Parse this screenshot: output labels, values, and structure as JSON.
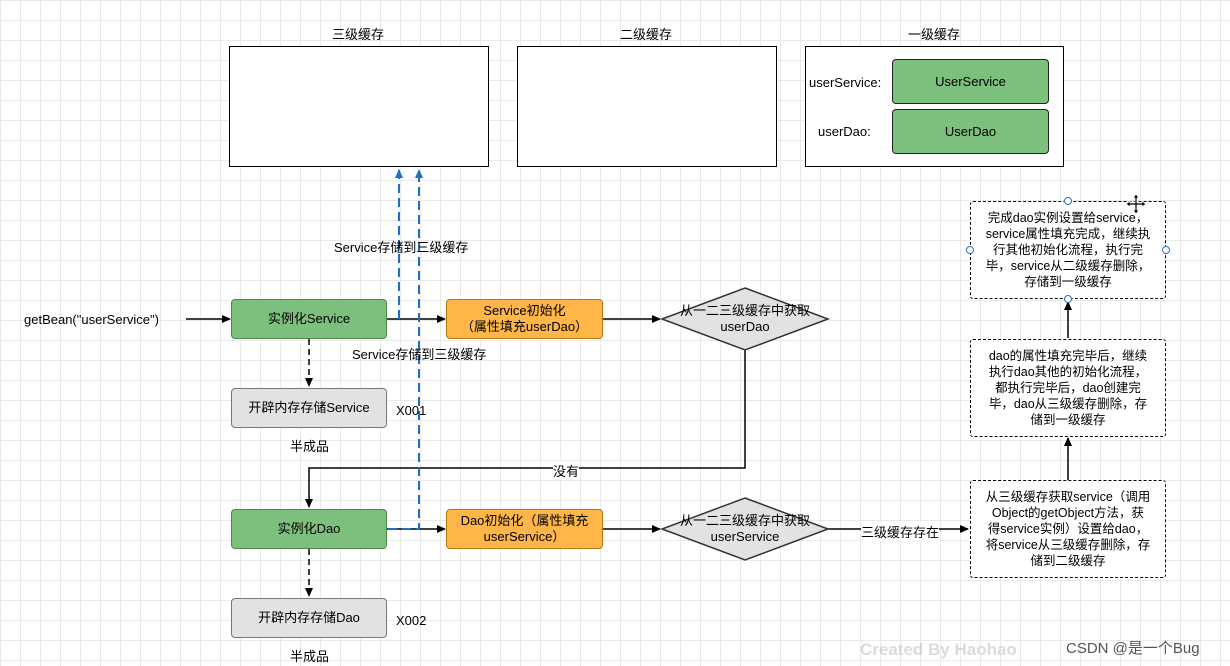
{
  "caches": {
    "level3": {
      "title": "三级缓存"
    },
    "level2": {
      "title": "二级缓存"
    },
    "level1": {
      "title": "一级缓存",
      "entries": [
        {
          "key": "userService:",
          "value": "UserService"
        },
        {
          "key": "userDao:",
          "value": "UserDao"
        }
      ]
    }
  },
  "flow": {
    "entry_label": "getBean(\"userService\")",
    "instantiate_service": "实例化Service",
    "service_memory": "开辟内存存储Service",
    "service_addr": "X001",
    "service_half": "半成品",
    "store_service_l3_a": "Service存储到三级缓存",
    "store_service_l3_b": "Service存储到三级缓存",
    "service_init_line1": "Service初始化",
    "service_init_line2": "（属性填充userDao）",
    "get_dao_line1": "从一二三级缓存中获取",
    "get_dao_line2": "userDao",
    "none_label": "没有",
    "instantiate_dao": "实例化Dao",
    "dao_memory": "开辟内存存储Dao",
    "dao_addr": "X002",
    "dao_half": "半成品",
    "dao_init_line1": "Dao初始化（属性填充",
    "dao_init_line2": "userService）",
    "get_service_line1": "从一二三级缓存中获取",
    "get_service_line2": "userService",
    "exists_label": "三级缓存存在"
  },
  "notes": {
    "note1": [
      "从三级缓存获取service（调用",
      "Object的getObject方法，获",
      "得service实例）设置给dao，",
      "将service从三级缓存删除，存",
      "储到二级缓存"
    ],
    "note2": [
      "dao的属性填充完毕后，继续",
      "执行dao其他的初始化流程，",
      "都执行完毕后，dao创建完",
      "毕，dao从三级缓存删除，存",
      "储到一级缓存"
    ],
    "note3": [
      "完成dao实例设置给service，",
      "service属性填充完成，继续执",
      "行其他初始化流程，执行完",
      "毕，service从二级缓存删除，",
      "存储到一级缓存"
    ]
  },
  "footer": {
    "watermark": "Created By Haohao",
    "csdn": "CSDN @是一个Bug"
  },
  "colors": {
    "green": "#7dbf7c",
    "orange": "#ffb648",
    "gray": "#e2e2e2",
    "blue_dashed": "#1f6fc5"
  }
}
